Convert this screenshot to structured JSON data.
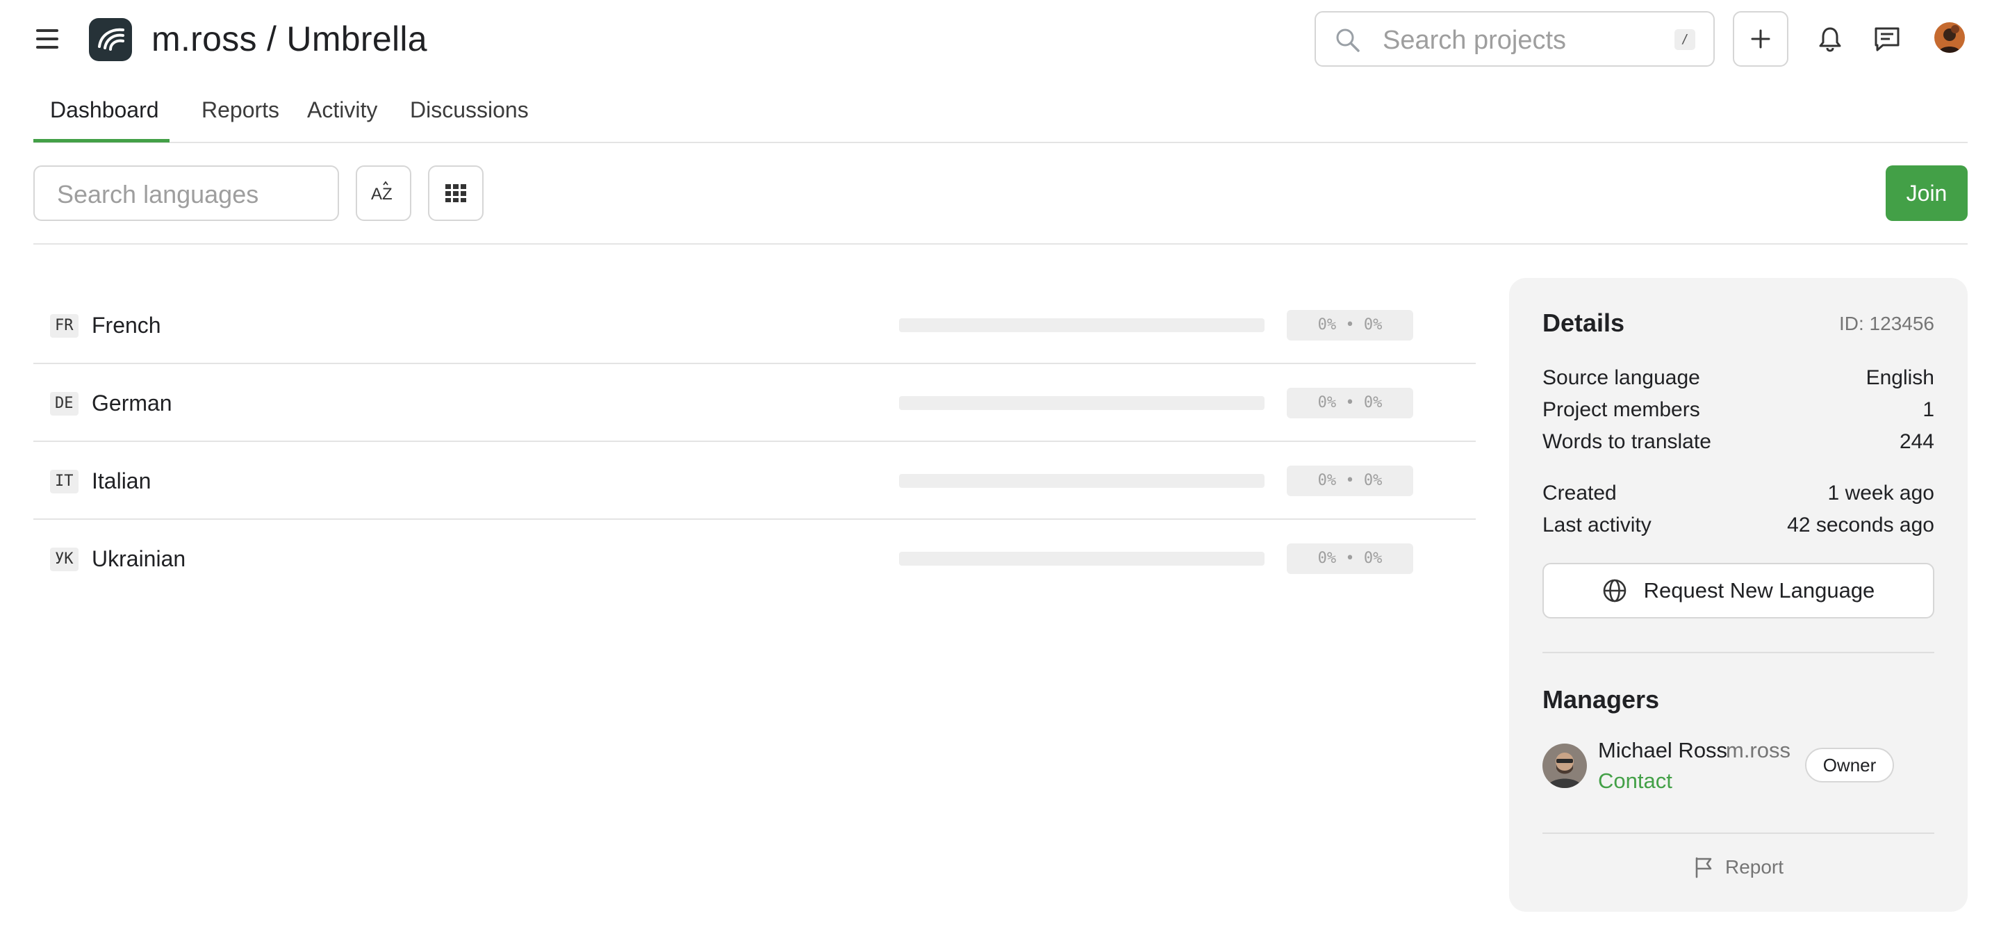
{
  "header": {
    "owner": "m.ross",
    "separator": "/",
    "project": "Umbrella",
    "search_placeholder": "Search projects",
    "search_shortcut": "/"
  },
  "tabs": [
    {
      "label": "Dashboard",
      "active": true
    },
    {
      "label": "Reports",
      "active": false
    },
    {
      "label": "Activity",
      "active": false
    },
    {
      "label": "Discussions",
      "active": false
    }
  ],
  "toolbar": {
    "search_placeholder": "Search languages",
    "sort_label": "AZ",
    "join_label": "Join"
  },
  "languages": [
    {
      "code": "FR",
      "name": "French",
      "progress_text": "0% • 0%",
      "translated_fraction": 0,
      "approved_fraction": 0
    },
    {
      "code": "DE",
      "name": "German",
      "progress_text": "0% • 0%",
      "translated_fraction": 0,
      "approved_fraction": 0
    },
    {
      "code": "IT",
      "name": "Italian",
      "progress_text": "0% • 0%",
      "translated_fraction": 0,
      "approved_fraction": 0
    },
    {
      "code": "УК",
      "name": "Ukrainian",
      "progress_text": "0% • 0%",
      "translated_fraction": 0,
      "approved_fraction": 0
    }
  ],
  "details": {
    "title": "Details",
    "id_label": "ID: 123456",
    "rows": [
      {
        "key": "Source language",
        "value": "English"
      },
      {
        "key": "Project members",
        "value": "1"
      },
      {
        "key": "Words to translate",
        "value": "244"
      },
      {
        "key": "Created",
        "value": "1 week ago"
      },
      {
        "key": "Last activity",
        "value": "42 seconds ago"
      }
    ],
    "request_language_label": "Request New Language"
  },
  "managers": {
    "title": "Managers",
    "list": [
      {
        "name": "Michael Ross",
        "username": "m.ross",
        "contact_label": "Contact",
        "role": "Owner"
      }
    ]
  },
  "report_label": "Report",
  "colors": {
    "accent": "#43a047",
    "border": "#d6d6d6",
    "card_bg": "#f3f3f3",
    "muted_text": "#757575"
  },
  "icons": [
    "menu-icon",
    "app-logo-icon",
    "search-icon",
    "plus-icon",
    "bell-icon",
    "chat-icon",
    "user-avatar",
    "sort-az-icon",
    "grid-icon",
    "globe-icon",
    "flag-icon"
  ]
}
